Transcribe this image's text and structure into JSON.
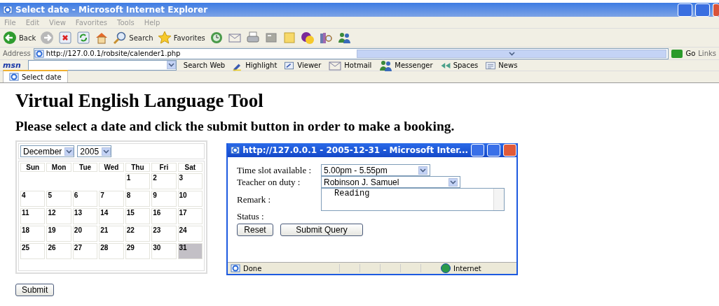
{
  "window": {
    "title": "Select date - Microsoft Internet Explorer"
  },
  "menu": [
    "File",
    "Edit",
    "View",
    "Favorites",
    "Tools",
    "Help"
  ],
  "toolbar": [
    {
      "kind": "back",
      "label": "Back"
    },
    {
      "kind": "forward"
    },
    {
      "kind": "stop"
    },
    {
      "kind": "refresh"
    },
    {
      "kind": "home"
    },
    {
      "kind": "search",
      "label": "Search"
    },
    {
      "kind": "favorites",
      "label": "Favorites"
    },
    {
      "kind": "history"
    },
    {
      "kind": "mail"
    },
    {
      "kind": "print"
    },
    {
      "kind": "edit"
    },
    {
      "kind": "note"
    },
    {
      "kind": "chat"
    },
    {
      "kind": "research"
    },
    {
      "kind": "people"
    }
  ],
  "address": {
    "label": "Address",
    "value": "http://127.0.0.1/robsite/calender1.php",
    "go": "Go",
    "links": "Links"
  },
  "msn_bar": {
    "logo": "msn",
    "search_label": "Search Web",
    "items": [
      {
        "kind": "highlight",
        "label": "Highlight"
      },
      {
        "kind": "viewer",
        "label": "Viewer"
      },
      {
        "kind": "mail",
        "label": "Hotmail"
      },
      {
        "kind": "people",
        "label": "Messenger"
      },
      {
        "kind": "spaces",
        "label": "Spaces"
      },
      {
        "kind": "news",
        "label": "News"
      }
    ]
  },
  "tabs": [
    {
      "label": "Select date",
      "selected": true
    }
  ],
  "page": {
    "heading": "Virtual English Language Tool",
    "instruction": "Please select a date and click the submit button in order to make a booking.",
    "calendar": {
      "month": "December",
      "year": "2005",
      "weekdays": [
        "Sun",
        "Mon",
        "Tue",
        "Wed",
        "Thu",
        "Fri",
        "Sat"
      ],
      "weeks": [
        [
          {
            "kind": "blank"
          },
          {
            "kind": "blank"
          },
          {
            "kind": "blank"
          },
          {
            "kind": "blank"
          },
          {
            "day": "1",
            "selected": false
          },
          {
            "day": "2",
            "selected": false
          },
          {
            "day": "3",
            "selected": false
          }
        ],
        [
          {
            "day": "4",
            "selected": false
          },
          {
            "day": "5",
            "selected": false
          },
          {
            "day": "6",
            "selected": false
          },
          {
            "day": "7",
            "selected": false
          },
          {
            "day": "8",
            "selected": false
          },
          {
            "day": "9",
            "selected": false
          },
          {
            "day": "10",
            "selected": false
          }
        ],
        [
          {
            "day": "11",
            "selected": false
          },
          {
            "day": "12",
            "selected": false
          },
          {
            "day": "13",
            "selected": false
          },
          {
            "day": "14",
            "selected": false
          },
          {
            "day": "15",
            "selected": false
          },
          {
            "day": "16",
            "selected": false
          },
          {
            "day": "17",
            "selected": false
          }
        ],
        [
          {
            "day": "18",
            "selected": false
          },
          {
            "day": "19",
            "selected": false
          },
          {
            "day": "20",
            "selected": false
          },
          {
            "day": "21",
            "selected": false
          },
          {
            "day": "22",
            "selected": false
          },
          {
            "day": "23",
            "selected": false
          },
          {
            "day": "24",
            "selected": false
          }
        ],
        [
          {
            "day": "25",
            "selected": false
          },
          {
            "day": "26",
            "selected": false
          },
          {
            "day": "27",
            "selected": false
          },
          {
            "day": "28",
            "selected": false
          },
          {
            "day": "29",
            "selected": false
          },
          {
            "day": "30",
            "selected": false
          },
          {
            "day": "31",
            "selected": true
          }
        ]
      ]
    },
    "submit": "Submit"
  },
  "popup": {
    "title": "http://127.0.0.1 - 2005-12-31 - Microsoft Inter...",
    "time_label": "Time slot available :",
    "time_value": "5.00pm - 5.55pm",
    "teacher_label": "Teacher on duty :",
    "teacher_value": "Robinson J. Samuel",
    "remark_label": "Remark :",
    "remark_value": "Reading",
    "status_label": "Status :",
    "buttons": [
      "Reset",
      "Submit Query"
    ],
    "status_text": "Done",
    "zone": "Internet"
  }
}
